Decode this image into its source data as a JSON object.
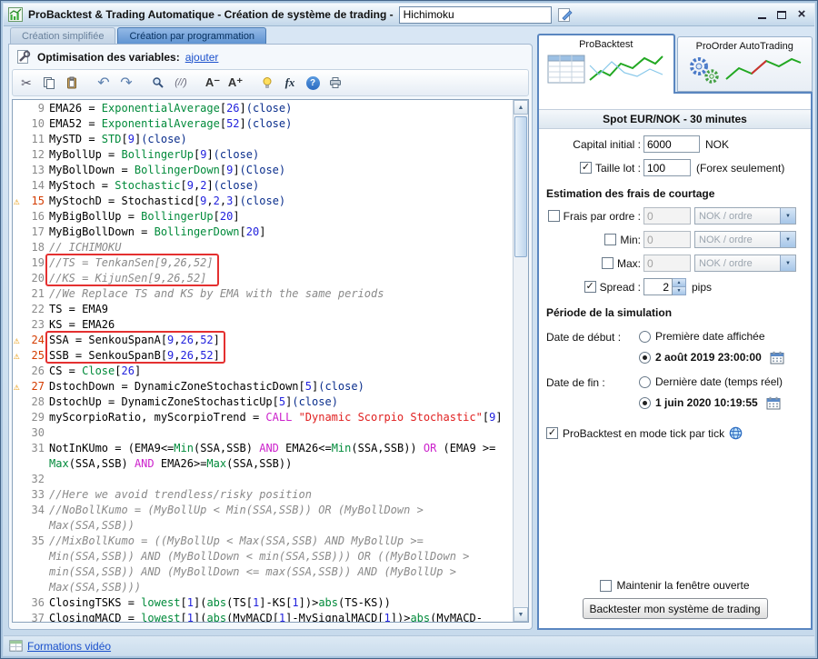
{
  "window": {
    "title": "ProBacktest & Trading Automatique - Création de système de trading -",
    "name_value": "Hichimoku"
  },
  "icons": {
    "check": "✓",
    "warning": "⚠",
    "cut": "✂",
    "undo": "↶",
    "redo": "↷",
    "up_arrow": "▲",
    "down_arrow": "▼",
    "close": "×"
  },
  "tabs": {
    "simplified": "Création simplifiée",
    "programming": "Création par programmation"
  },
  "editor": {
    "opt_label": "Optimisation des variables:",
    "opt_link": "ajouter",
    "toolbar": {
      "comment": "(//)",
      "font_down": "A⁻",
      "font_up": "A⁺",
      "fx": "fx",
      "help": "?"
    }
  },
  "code": {
    "red_boxes": [
      [
        19,
        20
      ],
      [
        24,
        25
      ]
    ],
    "lines": [
      {
        "n": 9,
        "s": [
          [
            "t",
            "EMA26 = "
          ],
          [
            "f",
            "ExponentialAverage"
          ],
          [
            "t",
            "["
          ],
          [
            "n",
            "26"
          ],
          [
            "t",
            "]"
          ],
          [
            "p",
            "(close)"
          ]
        ]
      },
      {
        "n": 10,
        "s": [
          [
            "t",
            "EMA52 = "
          ],
          [
            "f",
            "ExponentialAverage"
          ],
          [
            "t",
            "["
          ],
          [
            "n",
            "52"
          ],
          [
            "t",
            "]"
          ],
          [
            "p",
            "(close)"
          ]
        ]
      },
      {
        "n": 11,
        "s": [
          [
            "t",
            "MySTD = "
          ],
          [
            "f",
            "STD"
          ],
          [
            "t",
            "["
          ],
          [
            "n",
            "9"
          ],
          [
            "t",
            "]"
          ],
          [
            "p",
            "(close)"
          ]
        ]
      },
      {
        "n": 12,
        "s": [
          [
            "t",
            "MyBollUp = "
          ],
          [
            "f",
            "BollingerUp"
          ],
          [
            "t",
            "["
          ],
          [
            "n",
            "9"
          ],
          [
            "t",
            "]"
          ],
          [
            "p",
            "(close)"
          ]
        ]
      },
      {
        "n": 13,
        "s": [
          [
            "t",
            "MyBollDown = "
          ],
          [
            "f",
            "BollingerDown"
          ],
          [
            "t",
            "["
          ],
          [
            "n",
            "9"
          ],
          [
            "t",
            "]"
          ],
          [
            "p",
            "(Close)"
          ]
        ]
      },
      {
        "n": 14,
        "s": [
          [
            "t",
            "MyStoch = "
          ],
          [
            "f",
            "Stochastic"
          ],
          [
            "t",
            "["
          ],
          [
            "n",
            "9"
          ],
          [
            "t",
            ","
          ],
          [
            "n",
            "2"
          ],
          [
            "t",
            "]"
          ],
          [
            "p",
            "(close)"
          ]
        ]
      },
      {
        "n": 15,
        "w": 1,
        "s": [
          [
            "t",
            "MyStochD = Stochasticd["
          ],
          [
            "n",
            "9"
          ],
          [
            "t",
            ","
          ],
          [
            "n",
            "2"
          ],
          [
            "t",
            ","
          ],
          [
            "n",
            "3"
          ],
          [
            "t",
            "]"
          ],
          [
            "p",
            "(close)"
          ]
        ]
      },
      {
        "n": 16,
        "s": [
          [
            "t",
            "MyBigBollUp = "
          ],
          [
            "f",
            "BollingerUp"
          ],
          [
            "t",
            "["
          ],
          [
            "n",
            "20"
          ],
          [
            "t",
            "]"
          ]
        ]
      },
      {
        "n": 17,
        "s": [
          [
            "t",
            "MyBigBollDown = "
          ],
          [
            "f",
            "BollingerDown"
          ],
          [
            "t",
            "["
          ],
          [
            "n",
            "20"
          ],
          [
            "t",
            "]"
          ]
        ]
      },
      {
        "n": 18,
        "s": [
          [
            "c",
            "// ICHIMOKU"
          ]
        ]
      },
      {
        "n": 19,
        "s": [
          [
            "c",
            "//TS = TenkanSen[9,26,52]"
          ]
        ]
      },
      {
        "n": 20,
        "s": [
          [
            "c",
            "//KS = KijunSen[9,26,52]"
          ]
        ]
      },
      {
        "n": 21,
        "s": [
          [
            "c",
            "//We Replace TS and KS by EMA with the same periods"
          ]
        ]
      },
      {
        "n": 22,
        "s": [
          [
            "t",
            "TS = EMA9"
          ]
        ]
      },
      {
        "n": 23,
        "s": [
          [
            "t",
            "KS = EMA26"
          ]
        ]
      },
      {
        "n": 24,
        "w": 1,
        "s": [
          [
            "t",
            "SSA = SenkouSpanA["
          ],
          [
            "n",
            "9"
          ],
          [
            "t",
            ","
          ],
          [
            "n",
            "26"
          ],
          [
            "t",
            ","
          ],
          [
            "n",
            "52"
          ],
          [
            "t",
            "]"
          ]
        ]
      },
      {
        "n": 25,
        "w": 1,
        "s": [
          [
            "t",
            "SSB = SenkouSpanB["
          ],
          [
            "n",
            "9"
          ],
          [
            "t",
            ","
          ],
          [
            "n",
            "26"
          ],
          [
            "t",
            ","
          ],
          [
            "n",
            "52"
          ],
          [
            "t",
            "]"
          ]
        ]
      },
      {
        "n": 26,
        "s": [
          [
            "t",
            "CS = "
          ],
          [
            "f",
            "Close"
          ],
          [
            "t",
            "["
          ],
          [
            "n",
            "26"
          ],
          [
            "t",
            "]"
          ]
        ]
      },
      {
        "n": 27,
        "w": 1,
        "s": [
          [
            "t",
            "DstochDown = DynamicZoneStochasticDown["
          ],
          [
            "n",
            "5"
          ],
          [
            "t",
            "]"
          ],
          [
            "p",
            "(close)"
          ]
        ]
      },
      {
        "n": 28,
        "s": [
          [
            "t",
            "DstochUp = DynamicZoneStochasticUp["
          ],
          [
            "n",
            "5"
          ],
          [
            "t",
            "]"
          ],
          [
            "p",
            "(close)"
          ]
        ]
      },
      {
        "n": 29,
        "s": [
          [
            "t",
            "myScorpioRatio, myScorpioTrend = "
          ],
          [
            "k",
            "CALL"
          ],
          [
            "t",
            " "
          ],
          [
            "s",
            "\"Dynamic Scorpio Stochastic\""
          ],
          [
            "t",
            "["
          ],
          [
            "n",
            "9"
          ],
          [
            "t",
            "]"
          ]
        ]
      },
      {
        "n": 30,
        "s": []
      },
      {
        "n": 31,
        "s": [
          [
            "t",
            "NotInKUmo = (EMA9<="
          ],
          [
            "f",
            "Min"
          ],
          [
            "t",
            "(SSA,SSB) "
          ],
          [
            "k",
            "AND"
          ],
          [
            "t",
            " EMA26<="
          ],
          [
            "f",
            "Min"
          ],
          [
            "t",
            "(SSA,SSB)) "
          ],
          [
            "k",
            "OR"
          ],
          [
            "t",
            " (EMA9 >= "
          ],
          [
            "f",
            "Max"
          ],
          [
            "t",
            "(SSA,SSB) "
          ],
          [
            "k",
            "AND"
          ],
          [
            "t",
            " EMA26>="
          ],
          [
            "f",
            "Max"
          ],
          [
            "t",
            "(SSA,SSB))"
          ]
        ]
      },
      {
        "n": 32,
        "s": []
      },
      {
        "n": 33,
        "s": [
          [
            "c",
            "//Here we avoid trendless/risky position"
          ]
        ]
      },
      {
        "n": 34,
        "s": [
          [
            "c",
            "//NoBollKumo = (MyBollUp < Min(SSA,SSB)) OR (MyBollDown > Max(SSA,SSB))"
          ]
        ]
      },
      {
        "n": 35,
        "s": [
          [
            "c",
            "//MixBollKumo = ((MyBollUp < Max(SSA,SSB) AND MyBollUp >= Min(SSA,SSB)) AND (MyBollDown < min(SSA,SSB))) OR ((MyBollDown > min(SSA,SSB)) AND (MyBollDown <= max(SSA,SSB)) AND (MyBollUp > Max(SSA,SSB)))"
          ]
        ]
      },
      {
        "n": 36,
        "s": [
          [
            "t",
            "ClosingTSKS = "
          ],
          [
            "f",
            "lowest"
          ],
          [
            "t",
            "["
          ],
          [
            "n",
            "1"
          ],
          [
            "t",
            "]("
          ],
          [
            "f",
            "abs"
          ],
          [
            "t",
            "(TS["
          ],
          [
            "n",
            "1"
          ],
          [
            "t",
            "]-KS["
          ],
          [
            "n",
            "1"
          ],
          [
            "t",
            "])>"
          ],
          [
            "f",
            "abs"
          ],
          [
            "t",
            "(TS-KS))"
          ]
        ]
      },
      {
        "n": 37,
        "s": [
          [
            "t",
            "ClosingMACD = "
          ],
          [
            "f",
            "lowest"
          ],
          [
            "t",
            "["
          ],
          [
            "n",
            "1"
          ],
          [
            "t",
            "]("
          ],
          [
            "f",
            "abs"
          ],
          [
            "t",
            "(MyMACD["
          ],
          [
            "n",
            "1"
          ],
          [
            "t",
            "]-MySignalMACD["
          ],
          [
            "n",
            "1"
          ],
          [
            "t",
            "])>"
          ],
          [
            "f",
            "abs"
          ],
          [
            "t",
            "(MyMACD-"
          ]
        ]
      }
    ]
  },
  "backtest": {
    "tab_probacktest": "ProBacktest",
    "tab_proorder": "ProOrder AutoTrading",
    "instrument": "Spot EUR/NOK - 30 minutes",
    "capital_label": "Capital initial :",
    "capital_value": "6000",
    "capital_currency": "NOK",
    "lot_label": "Taille lot :",
    "lot_value": "100",
    "lot_note": "(Forex seulement)",
    "fees_header": "Estimation des frais de courtage",
    "fee_order_label": "Frais par ordre :",
    "fee_order_value": "0",
    "fee_order_unit": "NOK / ordre",
    "fee_min_label": "Min:",
    "fee_min_value": "0",
    "fee_min_unit": "NOK / ordre",
    "fee_max_label": "Max:",
    "fee_max_value": "0",
    "fee_max_unit": "NOK / ordre",
    "spread_label": "Spread :",
    "spread_value": "2",
    "spread_unit": "pips",
    "period_header": "Période de la simulation",
    "start_label": "Date de début :",
    "start_first": "Première date affichée",
    "start_date": "2 août 2019 23:00:00",
    "end_label": "Date de fin :",
    "end_last": "Dernière date (temps réel)",
    "end_date": "1 juin 2020 10:19:55",
    "tick_label": "ProBacktest en mode tick par tick",
    "keep_label": "Maintenir la fenêtre ouverte",
    "run_button": "Backtester mon système de trading"
  },
  "footer": {
    "link": "Formations vidéo"
  }
}
